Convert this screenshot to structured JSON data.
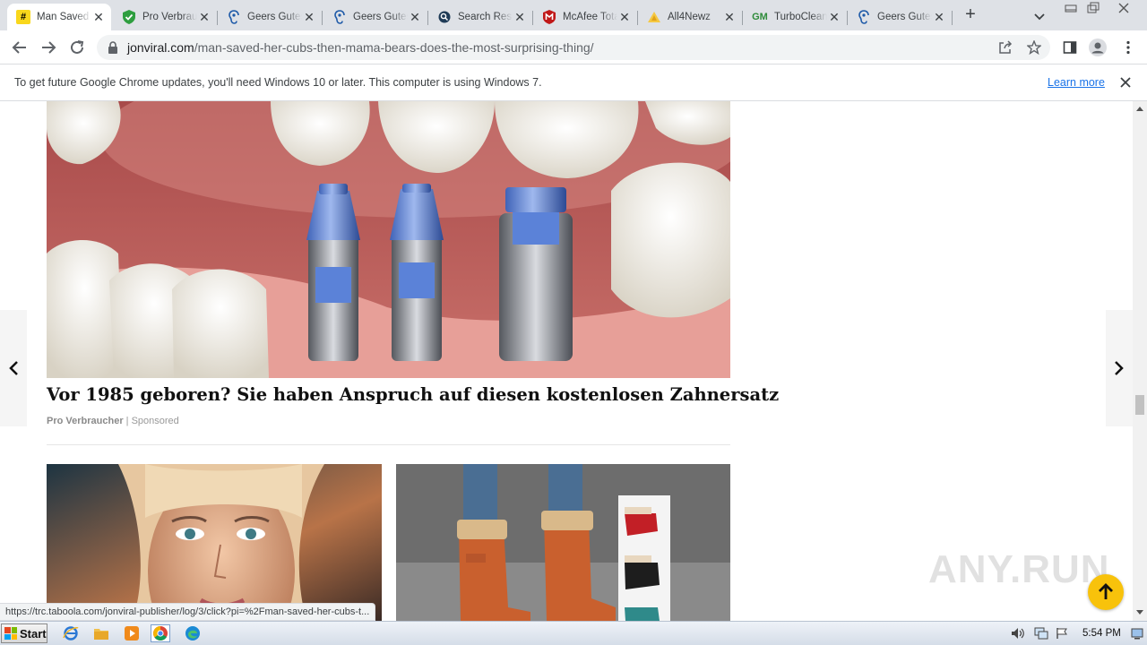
{
  "browser": {
    "tabs": [
      {
        "label": "Man Saved Her Cubs",
        "favicon": "hash-icon",
        "active": true
      },
      {
        "label": "Pro Verbraucher",
        "favicon": "shield-check-icon"
      },
      {
        "label": "Geers Gutes Hören",
        "favicon": "ear-icon"
      },
      {
        "label": "Geers Gutes Hören",
        "favicon": "ear-icon"
      },
      {
        "label": "Search Results",
        "favicon": "search-globe-icon"
      },
      {
        "label": "McAfee Total Protection",
        "favicon": "mcafee-icon"
      },
      {
        "label": "All4Newz",
        "favicon": "all4newz-icon"
      },
      {
        "label": "TurboCleaner",
        "favicon": "gm-icon"
      },
      {
        "label": "Geers Gutes Hören",
        "favicon": "ear-icon"
      }
    ],
    "url_host": "jonviral.com",
    "url_path": "/man-saved-her-cubs-then-mama-bears-does-the-most-surprising-thing/"
  },
  "infobar": {
    "message": "To get future Google Chrome updates, you'll need Windows 10 or later. This computer is using Windows 7.",
    "link": "Learn more"
  },
  "article": {
    "headline": "Vor 1985 geboren? Sie haben Anspruch auf diesen kostenlosen Zahnersatz",
    "brand": "Pro Verbraucher",
    "separator": "|",
    "sponsored": "Sponsored"
  },
  "status_url": "https://trc.taboola.com/jonviral-publisher/log/3/click?pi=%2Fman-saved-her-cubs-t...",
  "watermark": "ANY.RUN",
  "taskbar": {
    "start_label": "Start",
    "clock": "5:54 PM"
  },
  "colors": {
    "accent": "#1a73e8",
    "scroll_top_button": "#f8c20b",
    "tabstrip": "#dee1e6"
  }
}
